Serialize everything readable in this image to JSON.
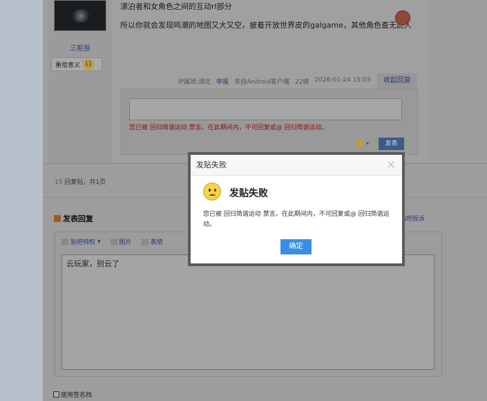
{
  "post": {
    "line1": "漂泊者和女角色之间的互动rl部分",
    "line2": "所以你就会发现鸣潮的地图又大又空，披着开放世界皮的galgame，其他角色查无此人",
    "username": "三拒投",
    "badge_label": "重拾意义",
    "badge_level": "11",
    "meta": {
      "ip": "IP属地:湖北",
      "report": "举报",
      "source": "来自Android客户端",
      "floor": "22楼",
      "time": "2026-01-24 15:03"
    },
    "collapse_reply": "收起回复",
    "ban_note": "您已被 回归简谐运动 禁言。在此期间内，不可回复或@ 回归简谐运动。",
    "submit_label": "发表"
  },
  "summary": {
    "count": "15",
    "text": "回复贴，共1页"
  },
  "compose": {
    "title": "发表回复",
    "complaint": "贴吧投诉",
    "toolbar": [
      "贴吧特权",
      "图片",
      "表情"
    ],
    "text": "云玩家，别云了",
    "signature": "使用签名档"
  },
  "modal": {
    "header": "发贴失败",
    "title": "发贴失败",
    "message": "您已被 回归简谐运动 禁言。在此期间内，不可回复或@ 回归简谐运动。",
    "ok": "确定",
    "close": "×"
  }
}
